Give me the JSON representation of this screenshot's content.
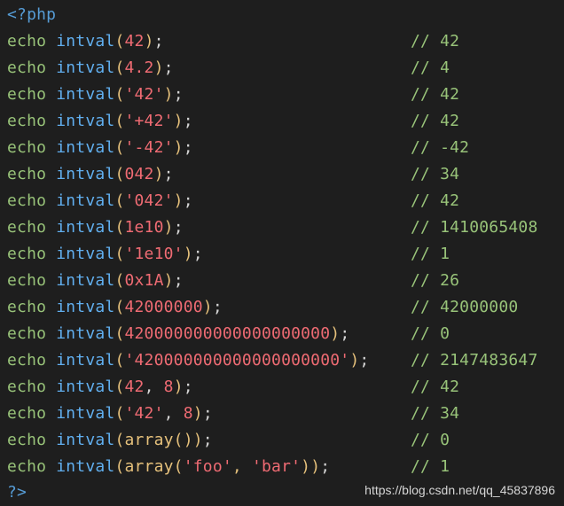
{
  "open_tag": "<?php",
  "close_tag": "?>",
  "lines": [
    {
      "kw": "echo",
      "fn": "intval",
      "open": "(",
      "a1": "42",
      "sep": "",
      "a2": "",
      "close": ")",
      "semi": ";",
      "comment": "// 42"
    },
    {
      "kw": "echo",
      "fn": "intval",
      "open": "(",
      "a1": "4.2",
      "sep": "",
      "a2": "",
      "close": ")",
      "semi": ";",
      "comment": "// 4"
    },
    {
      "kw": "echo",
      "fn": "intval",
      "open": "(",
      "a1": "'42'",
      "sep": "",
      "a2": "",
      "close": ")",
      "semi": ";",
      "comment": "// 42"
    },
    {
      "kw": "echo",
      "fn": "intval",
      "open": "(",
      "a1": "'+42'",
      "sep": "",
      "a2": "",
      "close": ")",
      "semi": ";",
      "comment": "// 42"
    },
    {
      "kw": "echo",
      "fn": "intval",
      "open": "(",
      "a1": "'-42'",
      "sep": "",
      "a2": "",
      "close": ")",
      "semi": ";",
      "comment": "// -42"
    },
    {
      "kw": "echo",
      "fn": "intval",
      "open": "(",
      "a1": "042",
      "sep": "",
      "a2": "",
      "close": ")",
      "semi": ";",
      "comment": "// 34"
    },
    {
      "kw": "echo",
      "fn": "intval",
      "open": "(",
      "a1": "'042'",
      "sep": "",
      "a2": "",
      "close": ")",
      "semi": ";",
      "comment": "// 42"
    },
    {
      "kw": "echo",
      "fn": "intval",
      "open": "(",
      "a1": "1e10",
      "sep": "",
      "a2": "",
      "close": ")",
      "semi": ";",
      "comment": "// 1410065408"
    },
    {
      "kw": "echo",
      "fn": "intval",
      "open": "(",
      "a1": "'1e10'",
      "sep": "",
      "a2": "",
      "close": ")",
      "semi": ";",
      "comment": "// 1"
    },
    {
      "kw": "echo",
      "fn": "intval",
      "open": "(",
      "a1": "0x1A",
      "sep": "",
      "a2": "",
      "close": ")",
      "semi": ";",
      "comment": "// 26"
    },
    {
      "kw": "echo",
      "fn": "intval",
      "open": "(",
      "a1": "42000000",
      "sep": "",
      "a2": "",
      "close": ")",
      "semi": ";",
      "comment": "// 42000000"
    },
    {
      "kw": "echo",
      "fn": "intval",
      "open": "(",
      "a1": "420000000000000000000",
      "sep": "",
      "a2": "",
      "close": ")",
      "semi": ";",
      "comment": "// 0"
    },
    {
      "kw": "echo",
      "fn": "intval",
      "open": "(",
      "a1": "'420000000000000000000'",
      "sep": "",
      "a2": "",
      "close": ")",
      "semi": ";",
      "comment": "// 2147483647"
    },
    {
      "kw": "echo",
      "fn": "intval",
      "open": "(",
      "a1": "42",
      "sep": ", ",
      "a2": "8",
      "close": ")",
      "semi": ";",
      "comment": "// 42"
    },
    {
      "kw": "echo",
      "fn": "intval",
      "open": "(",
      "a1": "'42'",
      "sep": ", ",
      "a2": "8",
      "close": ")",
      "semi": ";",
      "comment": "// 34"
    },
    {
      "kw": "echo",
      "fn": "intval",
      "open": "(",
      "a1": "array()",
      "sep": "",
      "a2": "",
      "close": ")",
      "semi": ";",
      "comment": "// 0"
    },
    {
      "kw": "echo",
      "fn": "intval",
      "open": "(",
      "a1": "array('foo', 'bar')",
      "sep": "",
      "a2": "",
      "close": ")",
      "semi": ";",
      "comment": "// 1"
    }
  ],
  "watermark": "https://blog.csdn.net/qq_45837896",
  "colors": {
    "background": "#1e1e1e",
    "keyword": "#98c379",
    "function": "#61afef",
    "number": "#ef6b73",
    "paren": "#e5c07b",
    "tag": "#569cd6"
  }
}
